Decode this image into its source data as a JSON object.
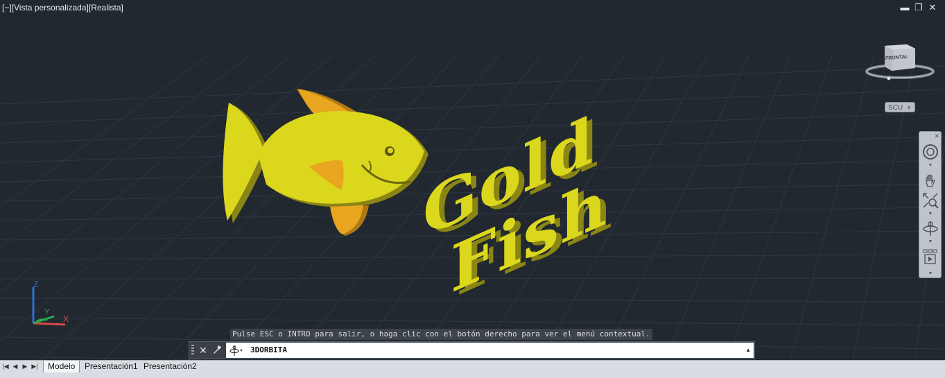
{
  "viewport": {
    "title": "[−][Vista personalizada][Realista]",
    "window_controls": {
      "minimize": "▬",
      "restore": "❐",
      "close": "✕"
    },
    "artwork": {
      "line1": "Gold",
      "line2": "Fish"
    },
    "ucs_icon": {
      "z_label": "Z",
      "y_label": "Y",
      "x_label": "X"
    }
  },
  "viewcube": {
    "face_label": "FRONTAL",
    "ucs_menu": "SCU",
    "ucs_menu_icon": "chevron-down-icon"
  },
  "navbar": {
    "items": [
      {
        "icon": "steeringwheel-icon"
      },
      {
        "icon": "pan-icon"
      },
      {
        "icon": "zoom-extents-icon"
      },
      {
        "icon": "orbit-icon"
      },
      {
        "icon": "showmotion-icon"
      }
    ]
  },
  "command": {
    "message": "Pulse ESC o INTRO para salir, o haga clic con el botón derecho para ver el menú contextual.",
    "current": "3DORBITA",
    "close_icon": "✕",
    "customize_icon": "wrench-icon"
  },
  "tabs": {
    "items": [
      "Modelo",
      "Presentación1",
      "Presentación2"
    ],
    "active": "Modelo"
  },
  "colors": {
    "background": "#212830",
    "fish_body": "#dbd71c",
    "fish_side": "#8a8514",
    "fin": "#e8a51f"
  }
}
